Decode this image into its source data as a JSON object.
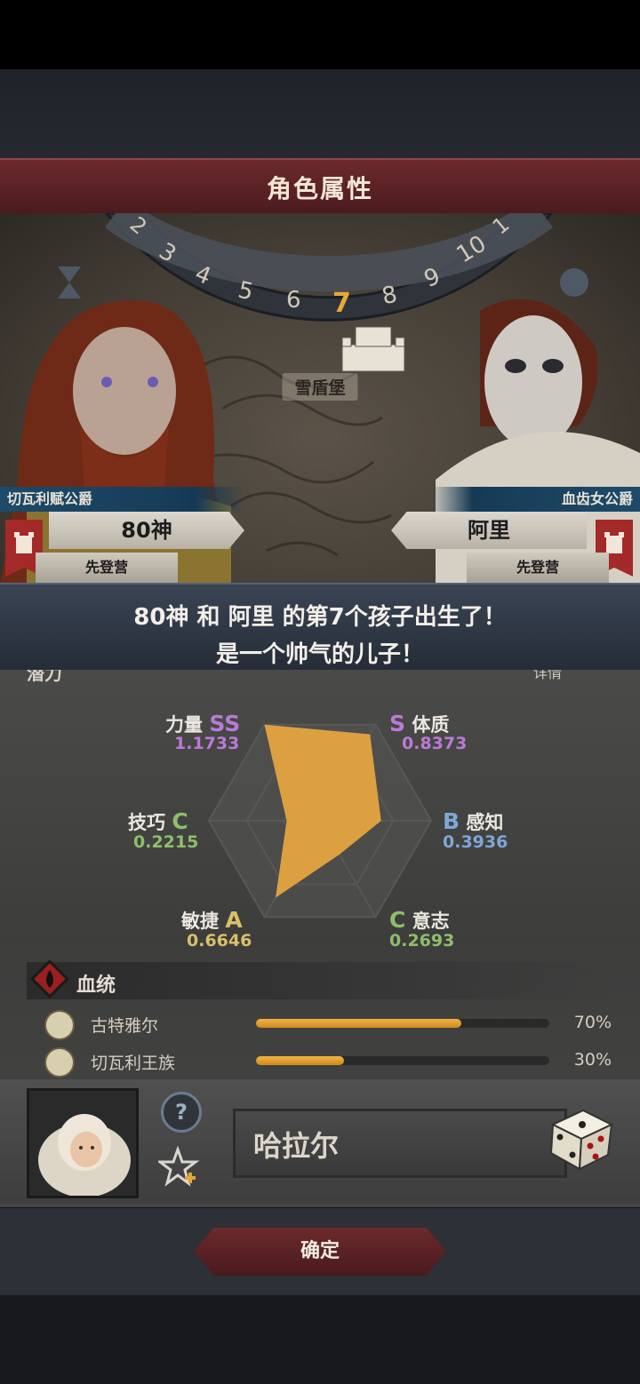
{
  "screen": {
    "title": "角色属性"
  },
  "scene": {
    "clock_numbers": [
      "2",
      "3",
      "4",
      "5",
      "6",
      "7",
      "8",
      "9",
      "10",
      "1"
    ],
    "current_number": "7",
    "location": "雪盾堡",
    "father": {
      "title": "切瓦利赋公爵",
      "name": "80神",
      "camp": "先登营"
    },
    "mother": {
      "title": "血齿女公爵",
      "name": "阿里",
      "camp": "先登营"
    }
  },
  "message": {
    "line1": "80神 和 阿里 的第7个孩子出生了！",
    "line2": "是一个帅气的儿子！"
  },
  "panel": {
    "header_partial": "潜力",
    "detail_partial": "详情"
  },
  "stats": [
    {
      "label": "力量",
      "grade": "SS",
      "value": "1.1733",
      "color": "#b97bd6",
      "level": 1.0
    },
    {
      "label": "体质",
      "grade": "S",
      "value": "0.8373",
      "color": "#b97bd6",
      "level": 0.9
    },
    {
      "label": "感知",
      "grade": "B",
      "value": "0.3936",
      "color": "#7ea7d6",
      "level": 0.55
    },
    {
      "label": "意志",
      "grade": "C",
      "value": "0.2693",
      "color": "#8fbe6a",
      "level": 0.35
    },
    {
      "label": "敏捷",
      "grade": "A",
      "value": "0.6646",
      "color": "#d8c169",
      "level": 0.8
    },
    {
      "label": "技巧",
      "grade": "C",
      "value": "0.2215",
      "color": "#8fbe6a",
      "level": 0.3
    }
  ],
  "lineage": {
    "title": "血统",
    "items": [
      {
        "name": "古特雅尔",
        "percent": "70%",
        "fraction": 0.7
      },
      {
        "name": "切瓦利王族",
        "percent": "30%",
        "fraction": 0.3
      }
    ]
  },
  "child": {
    "name": "哈拉尔",
    "help_symbol": "?"
  },
  "buttons": {
    "confirm": "确定"
  }
}
